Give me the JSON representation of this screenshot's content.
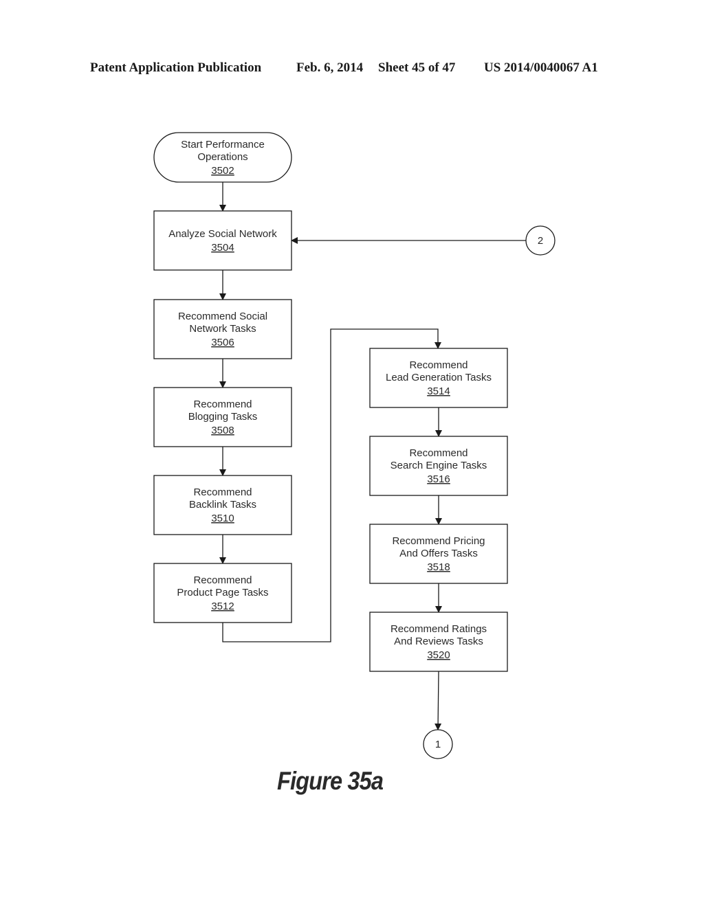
{
  "header": {
    "publication": "Patent Application Publication",
    "date": "Feb. 6, 2014",
    "sheet": "Sheet 45 of 47",
    "number": "US 2014/0040067 A1"
  },
  "figure_label": "Figure 35a",
  "nodes": {
    "n3502": {
      "shape": "terminal",
      "lines": [
        "Start Performance",
        "Operations"
      ],
      "ref": "3502"
    },
    "n3504": {
      "shape": "process",
      "lines": [
        "Analyze Social Network"
      ],
      "ref": "3504"
    },
    "n3506": {
      "shape": "process",
      "lines": [
        "Recommend Social",
        "Network Tasks"
      ],
      "ref": "3506"
    },
    "n3508": {
      "shape": "process",
      "lines": [
        "Recommend",
        "Blogging Tasks"
      ],
      "ref": "3508"
    },
    "n3510": {
      "shape": "process",
      "lines": [
        "Recommend",
        "Backlink Tasks"
      ],
      "ref": "3510"
    },
    "n3512": {
      "shape": "process",
      "lines": [
        "Recommend",
        "Product Page Tasks"
      ],
      "ref": "3512"
    },
    "n3514": {
      "shape": "process",
      "lines": [
        "Recommend",
        "Lead Generation Tasks"
      ],
      "ref": "3514"
    },
    "n3516": {
      "shape": "process",
      "lines": [
        "Recommend",
        "Search Engine Tasks"
      ],
      "ref": "3516"
    },
    "n3518": {
      "shape": "process",
      "lines": [
        "Recommend Pricing",
        "And Offers Tasks"
      ],
      "ref": "3518"
    },
    "n3520": {
      "shape": "process",
      "lines": [
        "Recommend Ratings",
        "And Reviews Tasks"
      ],
      "ref": "3520"
    },
    "c1": {
      "shape": "connector",
      "lines": [
        "1"
      ],
      "ref": ""
    },
    "c2": {
      "shape": "connector",
      "lines": [
        "2"
      ],
      "ref": ""
    }
  },
  "edges": [
    {
      "from": "n3502",
      "to": "n3504"
    },
    {
      "from": "c2",
      "to": "n3504"
    },
    {
      "from": "n3504",
      "to": "n3506"
    },
    {
      "from": "n3506",
      "to": "n3508"
    },
    {
      "from": "n3508",
      "to": "n3510"
    },
    {
      "from": "n3510",
      "to": "n3512"
    },
    {
      "from": "n3512",
      "to": "n3514"
    },
    {
      "from": "n3514",
      "to": "n3516"
    },
    {
      "from": "n3516",
      "to": "n3518"
    },
    {
      "from": "n3518",
      "to": "n3520"
    },
    {
      "from": "n3520",
      "to": "c1"
    }
  ]
}
